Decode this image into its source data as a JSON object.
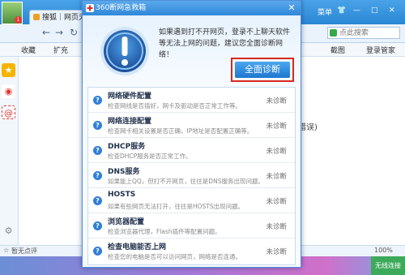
{
  "browser": {
    "tab_title": "搜狐｜网页无法",
    "avatar_badge": "1",
    "top_right": {
      "menu": "菜单"
    },
    "search": {
      "placeholder": "点此搜索"
    },
    "favbar": {
      "favorites": "收藏",
      "extension": "扩充",
      "screenshot": "截图",
      "login_manager": "登录管家"
    },
    "content_text": "错误)",
    "statusbar": {
      "left": "暂无点评"
    },
    "tray": {
      "zoom": "100%",
      "net": "无线连接"
    },
    "colors": {
      "tab_blue": "#2a86d4",
      "accent_red": "#d8281f"
    }
  },
  "dialog": {
    "title": "360断网急救箱",
    "close_icon": "close-icon",
    "hero_message": "如果遇到打不开网页，登录不上聊天软件等无法上网的问题，建议您全面诊断网络！",
    "primary_button": "全面诊断",
    "items": [
      {
        "title": "网络硬件配置",
        "desc": "检查网线是否插好，网卡及驱动是否正常工作等。",
        "status": "未诊断"
      },
      {
        "title": "网络连接配置",
        "desc": "检查网卡相关设置是否正确，IP地址是否配置正确等。",
        "status": "未诊断"
      },
      {
        "title": "DHCP服务",
        "desc": "检查DHCP服务是否正常工作。",
        "status": "未诊断"
      },
      {
        "title": "DNS服务",
        "desc": "如果能上QQ，但打不开网页，往往是DNS服务出现问题。",
        "status": "未诊断"
      },
      {
        "title": "HOSTS",
        "desc": "如果有些网页无法打开，往往是HOSTS出现问题。",
        "status": "未诊断"
      },
      {
        "title": "浏览器配置",
        "desc": "检查浏览器代理，Flash插件等配置问题。",
        "status": "未诊断"
      },
      {
        "title": "检查电脑能否上网",
        "desc": "检查您的电脑是否可以访问网页，网络是否连通。",
        "status": "未诊断"
      }
    ]
  }
}
